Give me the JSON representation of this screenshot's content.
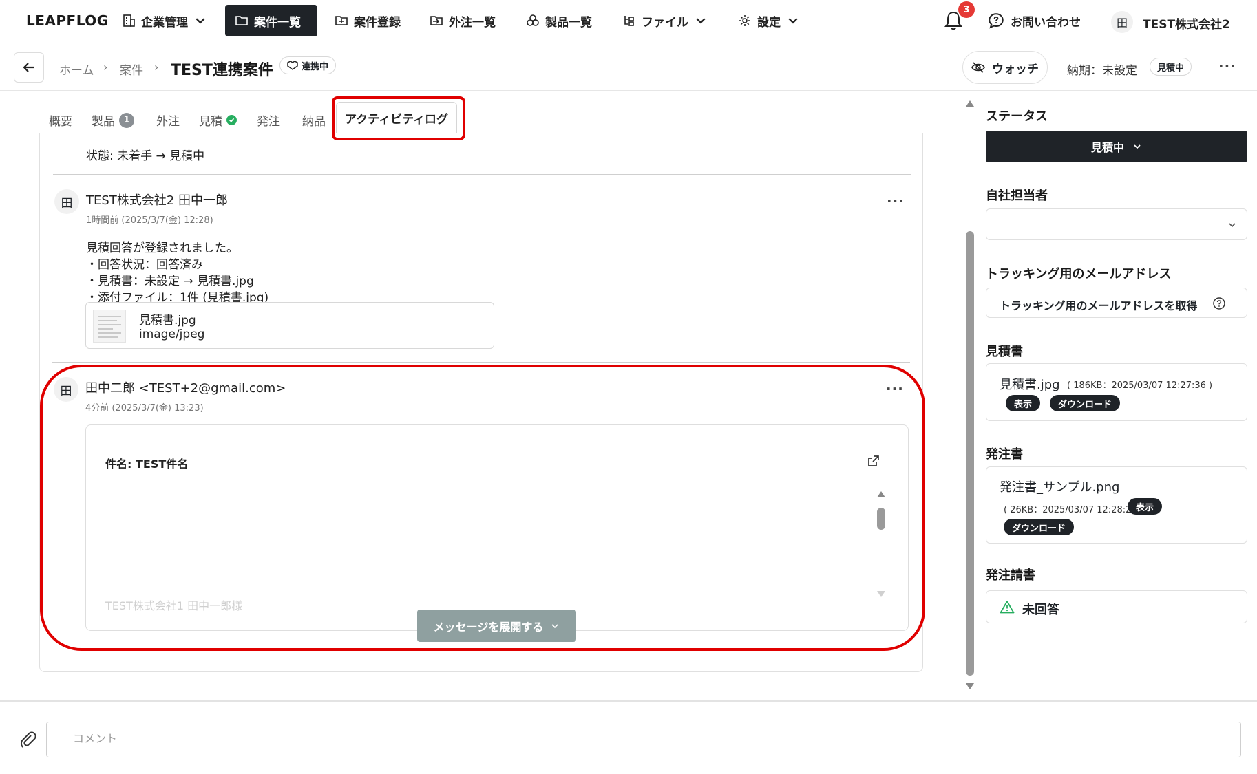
{
  "header": {
    "logo": "LEAPFLOG",
    "nav": [
      {
        "label": "企業管理",
        "icon": "building-icon"
      },
      {
        "label": "案件一覧",
        "icon": "folder-icon"
      },
      {
        "label": "案件登録",
        "icon": "folder-plus-icon"
      },
      {
        "label": "外注一覧",
        "icon": "folder-arrow-icon"
      },
      {
        "label": "製品一覧",
        "icon": "cubes-icon"
      },
      {
        "label": "ファイル",
        "icon": "file-tree-icon"
      },
      {
        "label": "設定",
        "icon": "gear-icon"
      }
    ],
    "notification_count": "3",
    "contact_label": "お問い合わせ",
    "company_avatar": "田",
    "company_name": "TEST株式会社2"
  },
  "subheader": {
    "breadcrumb": [
      "ホーム",
      "案件"
    ],
    "title": "TEST連携案件",
    "link_badge": "連携中",
    "watch_label": "ウォッチ",
    "due": "納期：未設定",
    "status_badge": "見積中",
    "more": "···"
  },
  "tabs": [
    {
      "label": "概要"
    },
    {
      "label": "製品",
      "count": "1"
    },
    {
      "label": "外注"
    },
    {
      "label": "見積"
    },
    {
      "label": "発注"
    },
    {
      "label": "納品"
    },
    {
      "label": "アクティビティログ"
    }
  ],
  "activity": {
    "state_change": "状態: 未着手 → 見積中",
    "entries": [
      {
        "avatar": "田",
        "author": "TEST株式会社2  田中一郎",
        "time": "1時間前 (2025/3/7(金) 12:28)",
        "lines": [
          "見積回答が登録されました。",
          "・回答状況：回答済み",
          "・見積書：未設定 → 見積書.jpg",
          "・添付ファイル：1件 (見積書.jpg)"
        ],
        "attachment": {
          "name": "見積書.jpg",
          "type": "image/jpeg"
        }
      },
      {
        "avatar": "田",
        "author": "田中二郎 <TEST+2@gmail.com>",
        "time": "4分前 (2025/3/7(金) 13:23)",
        "mail_subject": "件名: TEST件名",
        "mail_preview": "TEST株式会社1 田中一郎様",
        "expand_label": "メッセージを展開する"
      }
    ]
  },
  "sidebar": {
    "status_title": "ステータス",
    "status_value": "見積中",
    "owner_title": "自社担当者",
    "owner_value": "",
    "tracking_title": "トラッキング用のメールアドレス",
    "tracking_button": "トラッキング用のメールアドレスを取得",
    "quote_title": "見積書",
    "quote_file": "見積書.jpg",
    "quote_meta": "( 186KB：2025/03/07 12:27:36 )",
    "view_label": "表示",
    "download_label": "ダウンロード",
    "po_title": "発注書",
    "po_file": "発注書_サンプル.png",
    "po_meta": "( 26KB：2025/03/07 12:28:27 )",
    "po_confirm_title": "発注請書",
    "po_confirm_status": "未回答"
  },
  "comment": {
    "placeholder": "コメント"
  },
  "colors": {
    "accent_dark": "#1f2328",
    "annotation_red": "#e00000",
    "success_green": "#27ae60",
    "badge_red": "#e53935"
  }
}
